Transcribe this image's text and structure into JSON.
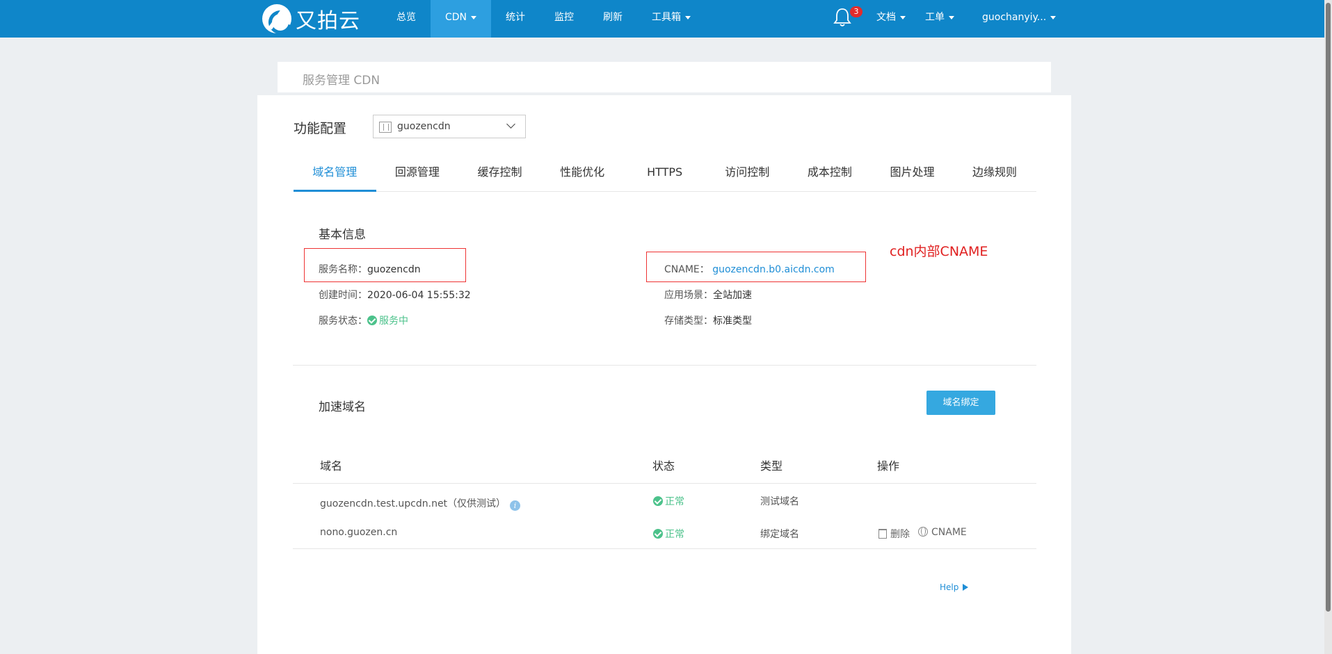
{
  "topbar": {
    "logo_text": "又拍云",
    "nav": [
      "总览",
      "CDN",
      "统计",
      "监控",
      "刷新",
      "工具箱"
    ],
    "active_nav": "CDN",
    "notification_count": "3",
    "docs": "文档",
    "ticket": "工单",
    "user": "guochanyiy..."
  },
  "breadcrumb": "服务管理 CDN",
  "config": {
    "title": "功能配置",
    "service_select": "guozencdn"
  },
  "tabs": [
    "域名管理",
    "回源管理",
    "缓存控制",
    "性能优化",
    "HTTPS",
    "访问控制",
    "成本控制",
    "图片处理",
    "边缘规则"
  ],
  "basic_info": {
    "title": "基本信息",
    "service_name_label": "服务名称：",
    "service_name": "guozencdn",
    "created_label": "创建时间：",
    "created": "2020-06-04 15:55:32",
    "status_label": "服务状态：",
    "status": "服务中",
    "cname_label": "CNAME：",
    "cname": "guozencdn.b0.aicdn.com",
    "scene_label": "应用场景：",
    "scene": "全站加速",
    "storage_label": "存储类型：",
    "storage": "标准类型",
    "annotation": "cdn内部CNAME"
  },
  "domains": {
    "title": "加速域名",
    "bind_button": "域名绑定",
    "columns": [
      "域名",
      "状态",
      "类型",
      "操作"
    ],
    "rows": [
      {
        "domain": "guozencdn.test.upcdn.net（仅供测试）",
        "status": "正常",
        "type": "测试域名"
      },
      {
        "domain": "nono.guozen.cn",
        "status": "正常",
        "type": "绑定域名",
        "delete": "删除",
        "cname": "CNAME"
      }
    ]
  },
  "help": "Help",
  "colors": {
    "nav_bg": "#0f86c9",
    "accent": "#1f8ed6",
    "ok": "#4cc28b",
    "annotation": "#e02020"
  }
}
